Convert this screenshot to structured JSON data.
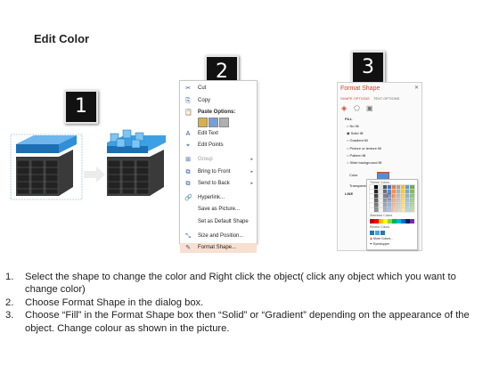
{
  "title": "Edit Color",
  "step_badges": [
    "1",
    "2",
    "3"
  ],
  "context_menu": {
    "items": [
      {
        "label": "Cut",
        "icon": "scissors-icon",
        "glyph": "✂",
        "state": "normal"
      },
      {
        "label": "Copy",
        "icon": "copy-icon",
        "glyph": "⎘",
        "state": "normal"
      },
      {
        "label": "Paste Options:",
        "icon": "paste-icon",
        "glyph": "📋",
        "state": "bold"
      },
      {
        "label": "Edit Text",
        "icon": "edit-text-icon",
        "glyph": "A",
        "state": "normal"
      },
      {
        "label": "Edit Points",
        "icon": "edit-points-icon",
        "glyph": "⌖",
        "state": "normal"
      },
      {
        "label": "Group",
        "icon": "group-icon",
        "glyph": "⊞",
        "state": "dim",
        "submenu": true
      },
      {
        "label": "Bring to Front",
        "icon": "bring-front-icon",
        "glyph": "⧉",
        "state": "normal",
        "submenu": true
      },
      {
        "label": "Send to Back",
        "icon": "send-back-icon",
        "glyph": "⧉",
        "state": "normal",
        "submenu": true
      },
      {
        "label": "Hyperlink...",
        "icon": "hyperlink-icon",
        "glyph": "🔗",
        "state": "normal"
      },
      {
        "label": "Save as Picture...",
        "icon": "",
        "glyph": "",
        "state": "normal"
      },
      {
        "label": "Set as Default Shape",
        "icon": "",
        "glyph": "",
        "state": "normal"
      },
      {
        "label": "Size and Position...",
        "icon": "size-icon",
        "glyph": "⤡",
        "state": "normal"
      },
      {
        "label": "Format Shape...",
        "icon": "format-shape-icon",
        "glyph": "✎",
        "state": "highlight"
      }
    ]
  },
  "format_pane": {
    "title": "Format Shape",
    "tabs": [
      "SHAPE OPTIONS",
      "TEXT OPTIONS"
    ],
    "section_fill": "FILL",
    "fill_options": [
      "No fill",
      "Solid fill",
      "Gradient fill",
      "Picture or texture fill",
      "Pattern fill",
      "Slide background fill"
    ],
    "color_label": "Color",
    "transparency_label": "Transparency",
    "section_line": "LINE",
    "palette": {
      "theme_label": "Theme Colors",
      "standard_label": "Standard Colors",
      "recent_label": "Recent Colors",
      "more_colors": "More Colors...",
      "eyedropper": "Eyedropper",
      "theme_colors": [
        "#ffffff",
        "#000000",
        "#e7e6e6",
        "#44546a",
        "#4472c4",
        "#ed7d31",
        "#a5a5a5",
        "#ffc000",
        "#5b9bd5",
        "#70ad47"
      ],
      "standard_colors": [
        "#c00000",
        "#ff0000",
        "#ffc000",
        "#ffff00",
        "#92d050",
        "#00b050",
        "#00b0f0",
        "#0070c0",
        "#002060",
        "#7030a0"
      ],
      "recent_colors": [
        "#1f77b4",
        "#41a7e1",
        "#2e75b6"
      ]
    }
  },
  "instructions": [
    {
      "num": "1.",
      "text": "Select the shape to change the color and Right click the object( click any object which you want to change color)"
    },
    {
      "num": "2.",
      "text": "Choose Format Shape in the dialog box."
    },
    {
      "num": "3.",
      "text": "Choose “Fill” in the Format Shape box then “Solid” or “Gradient” depending on the appearance of the object. Change colour as shown in the picture."
    }
  ],
  "colors": {
    "accent_blue": "#2f8fd8",
    "server_dark": "#2a2a2a",
    "menu_highlight": "#f8dfd0",
    "pane_accent": "#d24726"
  }
}
